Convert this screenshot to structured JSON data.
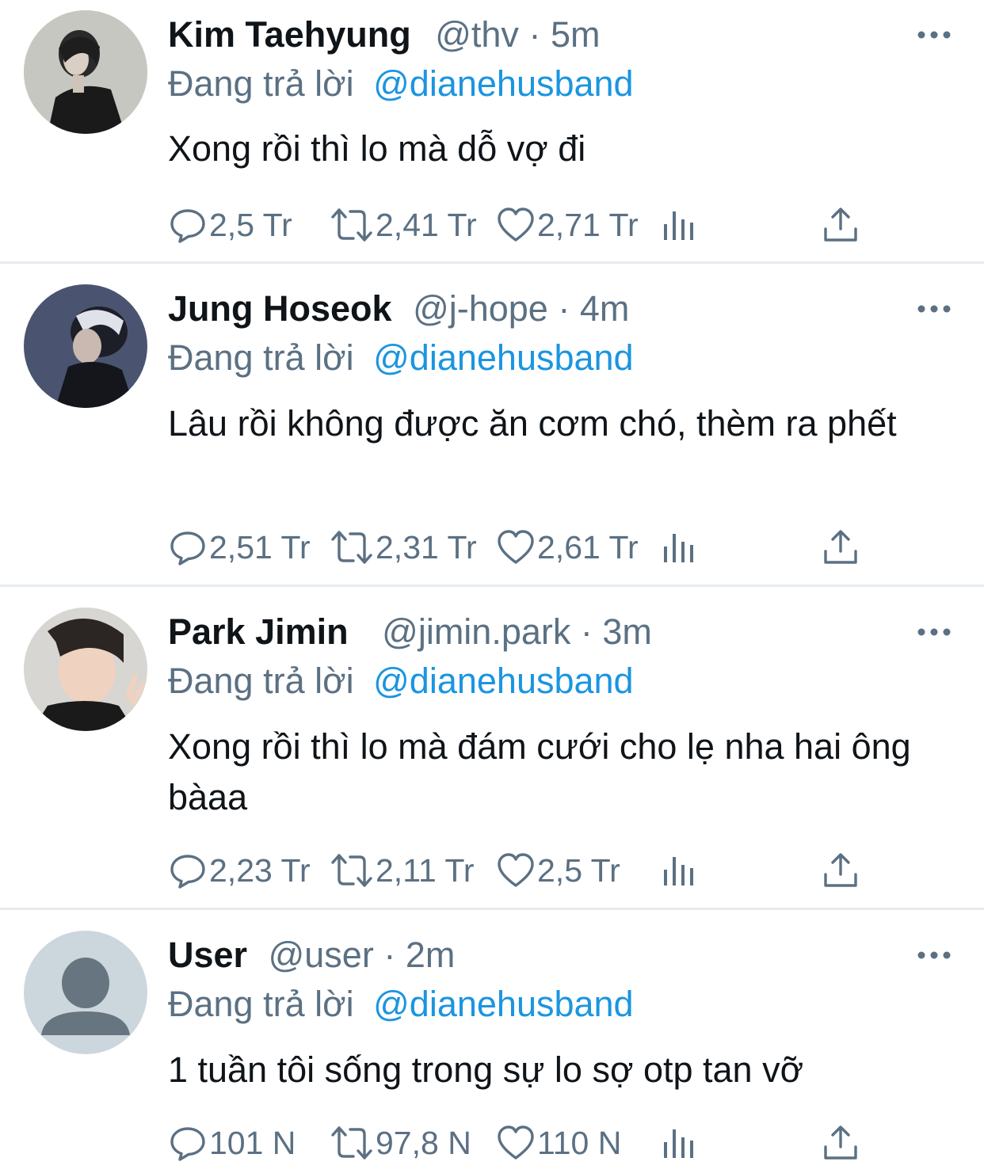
{
  "tweets": [
    {
      "name": "Kim Taehyung",
      "handle": "@thv",
      "dot": "·",
      "time": "5m",
      "reply_prefix": "Đang trả lời",
      "reply_to": "@dianehusband",
      "text": "Xong rồi thì lo mà dỗ vợ đi",
      "replies": "2,5 Tr",
      "retweets": "2,41 Tr",
      "likes": "2,71 Tr",
      "avatar": "photo-dark-jacket"
    },
    {
      "name": "Jung Hoseok",
      "handle": "@j-hope",
      "dot": "·",
      "time": "4m",
      "reply_prefix": "Đang trả lời",
      "reply_to": "@dianehusband",
      "text": "Lâu rồi không được ăn cơm chó, thèm ra phết",
      "replies": "2,51 Tr",
      "retweets": "2,31 Tr",
      "likes": "2,61 Tr",
      "avatar": "photo-navy-background"
    },
    {
      "name": "Park Jimin",
      "handle": "@jimin.park",
      "dot": "·",
      "time": "3m",
      "reply_prefix": "Đang trả lời",
      "reply_to": "@dianehusband",
      "text": "Xong rồi thì lo mà đám cưới cho lẹ nha hai ông bàaa",
      "replies": "2,23 Tr",
      "retweets": "2,11 Tr",
      "likes": "2,5 Tr",
      "avatar": "photo-peace-sign"
    },
    {
      "name": "User",
      "handle": "@user",
      "dot": "·",
      "time": "2m",
      "reply_prefix": "Đang trả lời",
      "reply_to": "@dianehusband",
      "text": "1 tuần tôi sống trong sự lo sợ otp tan vỡ",
      "replies": "101 N",
      "retweets": "97,8 N",
      "likes": "110 N",
      "avatar": "default-profile-icon"
    }
  ],
  "icons": {
    "reply": "reply-icon",
    "retweet": "retweet-icon",
    "like": "heart-icon",
    "analytics": "analytics-icon",
    "share": "share-icon",
    "more": "more-icon"
  },
  "colors": {
    "name": "#0f1419",
    "secondary": "#5b7083",
    "mention": "#1b95e0",
    "divider": "#e6ecf0"
  }
}
